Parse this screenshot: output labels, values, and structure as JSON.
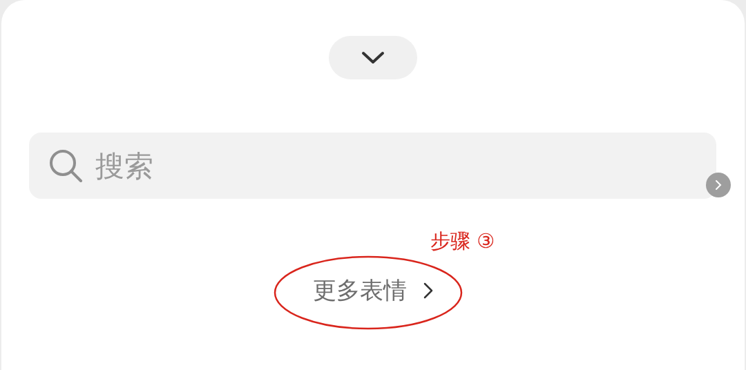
{
  "search": {
    "placeholder": "搜索"
  },
  "more_link": {
    "label": "更多表情"
  },
  "annotation": {
    "label": "步骤 ③"
  }
}
